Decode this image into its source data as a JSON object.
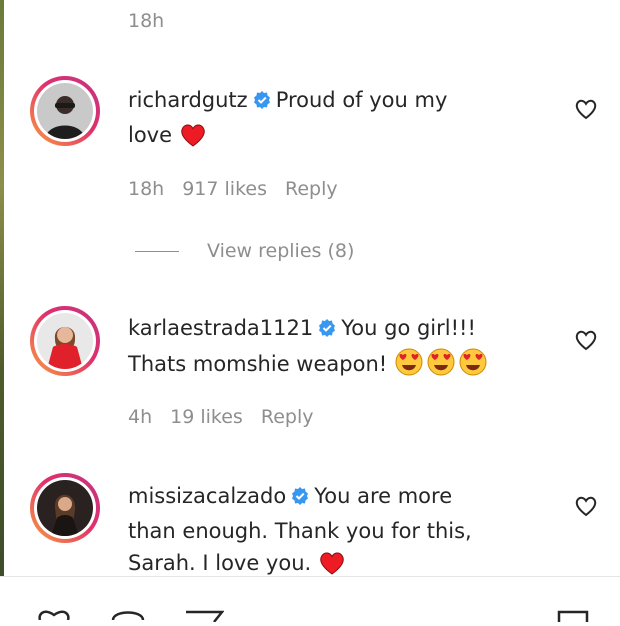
{
  "top": {
    "time": "18h"
  },
  "comments": [
    {
      "username": "richardgutz",
      "text_line1": "Proud of you my",
      "text_line2": "love",
      "time": "18h",
      "likes": "917 likes",
      "reply": "Reply"
    },
    {
      "username": "karlaestrada1121",
      "text_line1": "You go girl!!!",
      "text_line2": "Thats momshie weapon!",
      "time": "4h",
      "likes": "19 likes",
      "reply": "Reply"
    },
    {
      "username": "missizacalzado",
      "text_line1": "You are more",
      "text_line2": "than enough. Thank you for this,",
      "text_line3": "Sarah. I love you."
    }
  ],
  "view_replies": "View replies (8)",
  "colors": {
    "verified": "#3897f0",
    "heart": "#ed1c24",
    "muted": "#8e8e8e"
  },
  "icons": [
    "verified-icon",
    "heart-emoji-icon",
    "heart-eyes-emoji-icon",
    "like-heart-icon",
    "comment-icon",
    "share-icon",
    "bookmark-icon"
  ]
}
